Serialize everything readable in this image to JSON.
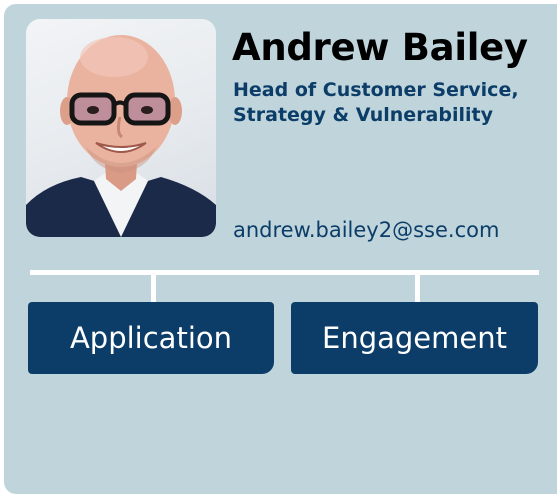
{
  "profile": {
    "name": "Andrew Bailey",
    "title_line1": "Head of Customer Service,",
    "title_line2": "Strategy & Vulnerability",
    "email": "andrew.bailey2@sse.com"
  },
  "tabs": [
    {
      "label": "Application"
    },
    {
      "label": "Engagement"
    }
  ],
  "colors": {
    "card_background": "#bfd5db",
    "accent_navy": "#0c3d68",
    "connector": "#ffffff"
  }
}
